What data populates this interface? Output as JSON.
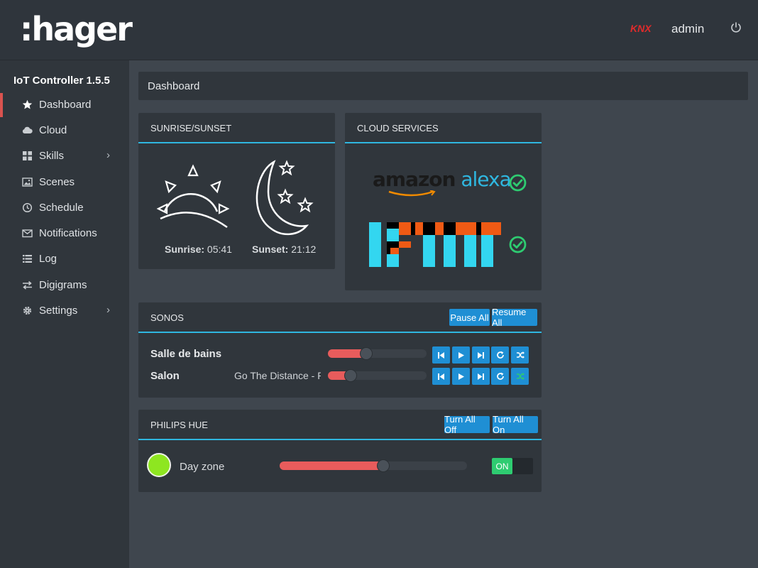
{
  "header": {
    "logo": ":hager",
    "knx_label": "KNX",
    "user": "admin",
    "power_icon": "power-icon"
  },
  "sidebar": {
    "version": "IoT Controller 1.5.5",
    "items": [
      {
        "label": "Dashboard",
        "icon": "star-icon",
        "active": true
      },
      {
        "label": "Cloud",
        "icon": "cloud-icon"
      },
      {
        "label": "Skills",
        "icon": "grid-icon",
        "has_submenu": true
      },
      {
        "label": "Scenes",
        "icon": "image-icon"
      },
      {
        "label": "Schedule",
        "icon": "clock-icon"
      },
      {
        "label": "Notifications",
        "icon": "envelope-icon"
      },
      {
        "label": "Log",
        "icon": "list-icon"
      },
      {
        "label": "Digigrams",
        "icon": "exchange-icon"
      },
      {
        "label": "Settings",
        "icon": "gear-icon",
        "has_submenu": true
      }
    ]
  },
  "breadcrumb": "Dashboard",
  "sunrise_panel": {
    "title": "SUNRISE/SUNSET",
    "sunrise_label": "Sunrise:",
    "sunrise_time": "05:41",
    "sunset_label": "Sunset:",
    "sunset_time": "21:12"
  },
  "cloud_panel": {
    "title": "CLOUD SERVICES",
    "services": [
      {
        "name": "amazon alexa",
        "status": "connected"
      },
      {
        "name": "IFTTT",
        "status": "connected"
      }
    ]
  },
  "sonos_panel": {
    "title": "SONOS",
    "pause_all": "Pause All",
    "resume_all": "Resume All",
    "rooms": [
      {
        "name": "Salle de bains",
        "track": "",
        "volume": 0.38
      },
      {
        "name": "Salon",
        "track": "Go The Distance - Rog",
        "volume": 0.22,
        "shuffle": true
      }
    ]
  },
  "hue_panel": {
    "title": "PHILIPS HUE",
    "turn_all_off": "Turn All Off",
    "turn_all_on": "Turn All On",
    "zones": [
      {
        "name": "Day zone",
        "color": "#8ee620",
        "brightness": 0.55,
        "state": "ON"
      }
    ]
  },
  "colors": {
    "accent": "#2fb7e0",
    "button": "#1f8fd4",
    "slider_fill": "#e85c5c",
    "status_ok": "#2ecc71",
    "active_marker": "#d9534f"
  }
}
